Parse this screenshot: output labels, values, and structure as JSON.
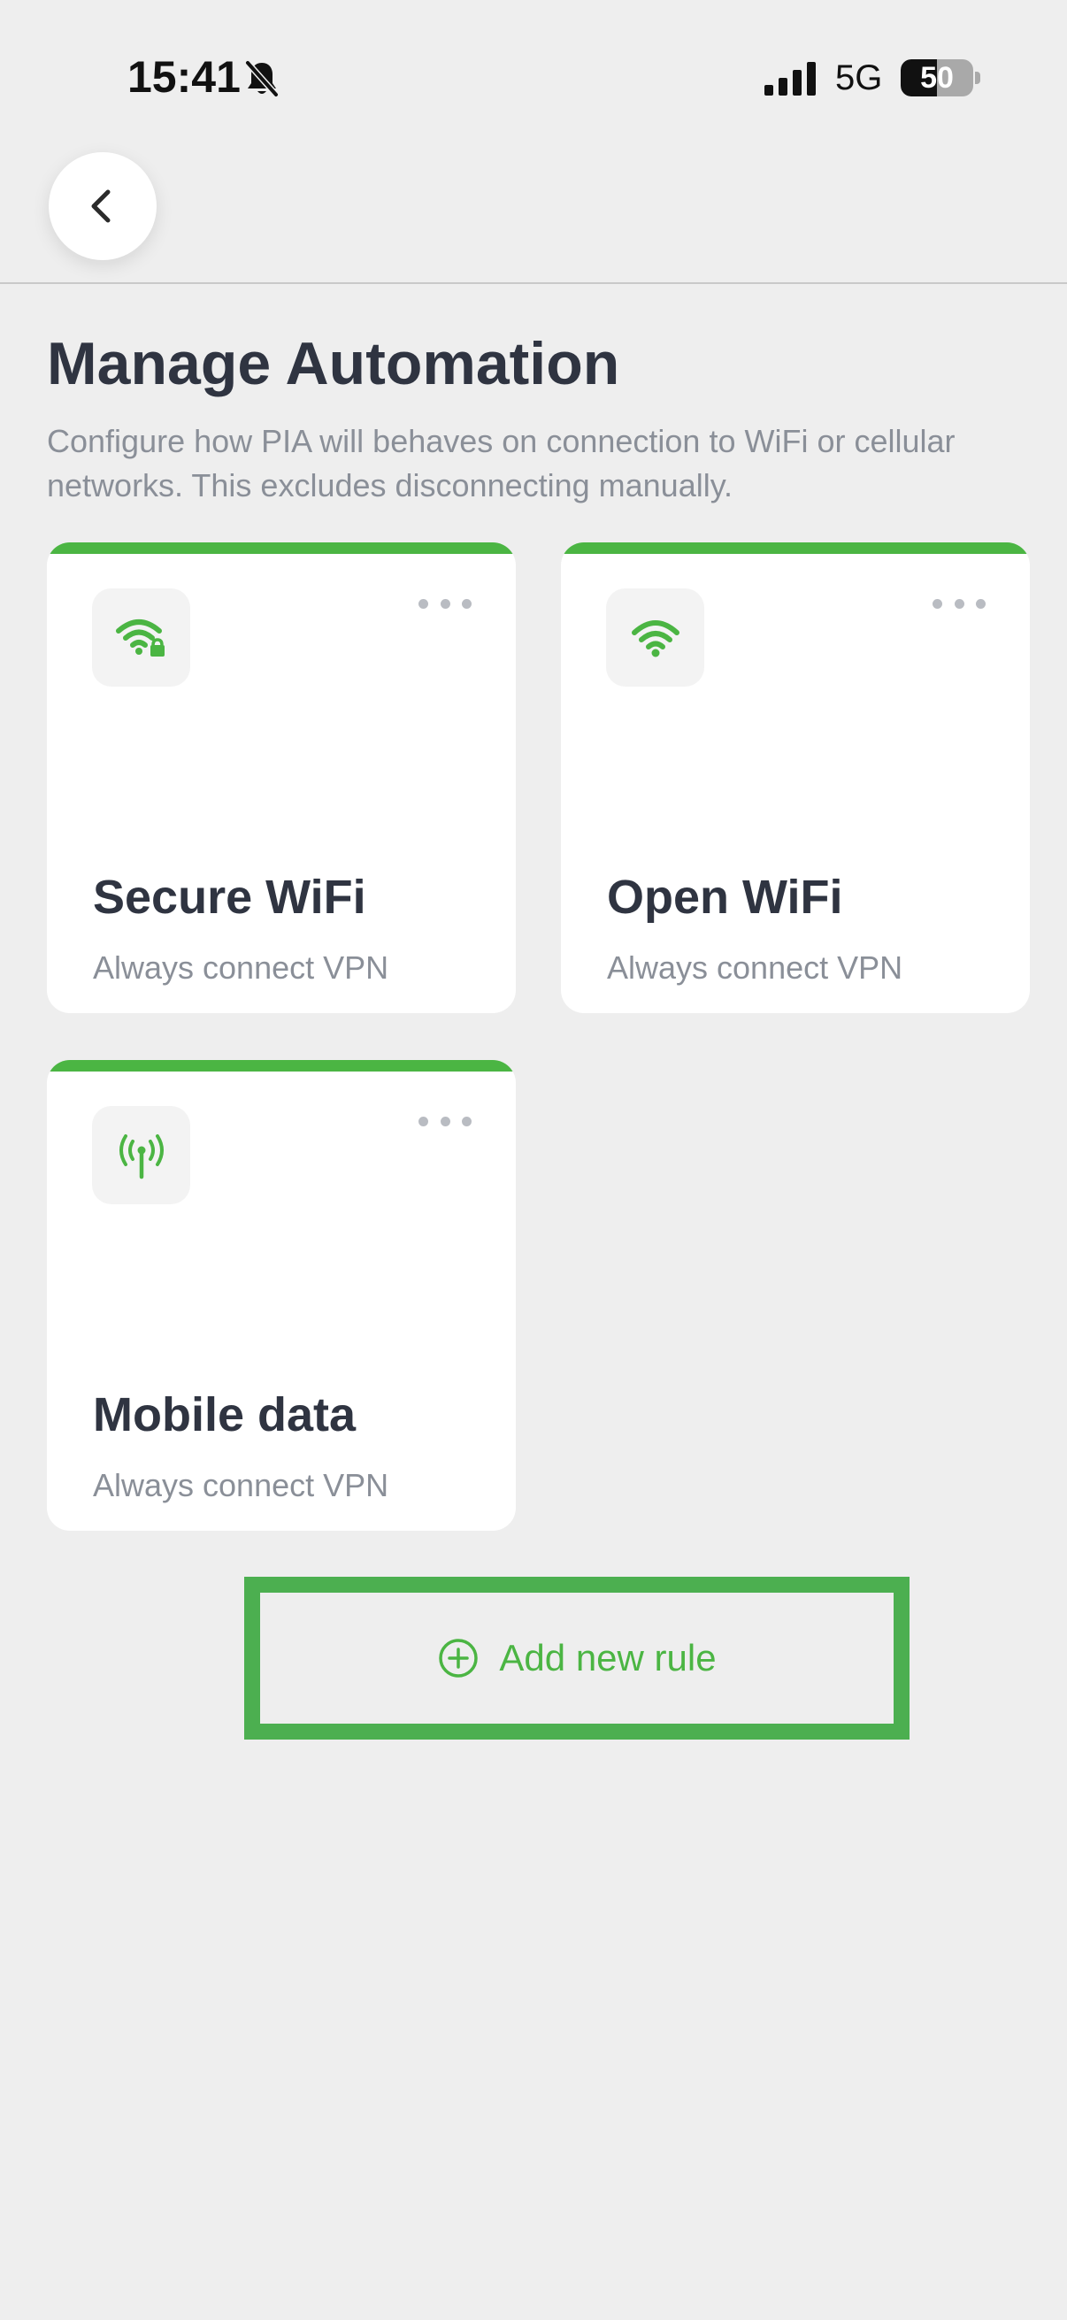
{
  "status_bar": {
    "time": "15:41",
    "network": "5G",
    "battery_percent": 50,
    "battery_label": "50",
    "icons": [
      "bell-slash-icon",
      "cellular-signal-icon",
      "battery-icon"
    ]
  },
  "header": {
    "back_icon": "chevron-left-icon"
  },
  "page": {
    "title": "Manage Automation",
    "subtitle": "Configure how PIA will behaves on connection to WiFi or cellular networks. This excludes disconnecting manually."
  },
  "rules": [
    {
      "title": "Secure WiFi",
      "description": "Always connect VPN",
      "icon": "secure-wifi-icon",
      "menu_icon": "more-horizontal-icon"
    },
    {
      "title": "Open WiFi",
      "description": "Always connect VPN",
      "icon": "wifi-icon",
      "menu_icon": "more-horizontal-icon"
    },
    {
      "title": "Mobile data",
      "description": "Always connect VPN",
      "icon": "cellular-antenna-icon",
      "menu_icon": "more-horizontal-icon"
    }
  ],
  "add_rule": {
    "label": "Add new rule",
    "icon": "plus-circle-icon"
  },
  "colors": {
    "accent": "#4bb543",
    "highlight": "#4caf50",
    "background": "#eeeeee",
    "card": "#ffffff",
    "title_text": "#2f3441",
    "secondary_text": "#8a8f98"
  }
}
